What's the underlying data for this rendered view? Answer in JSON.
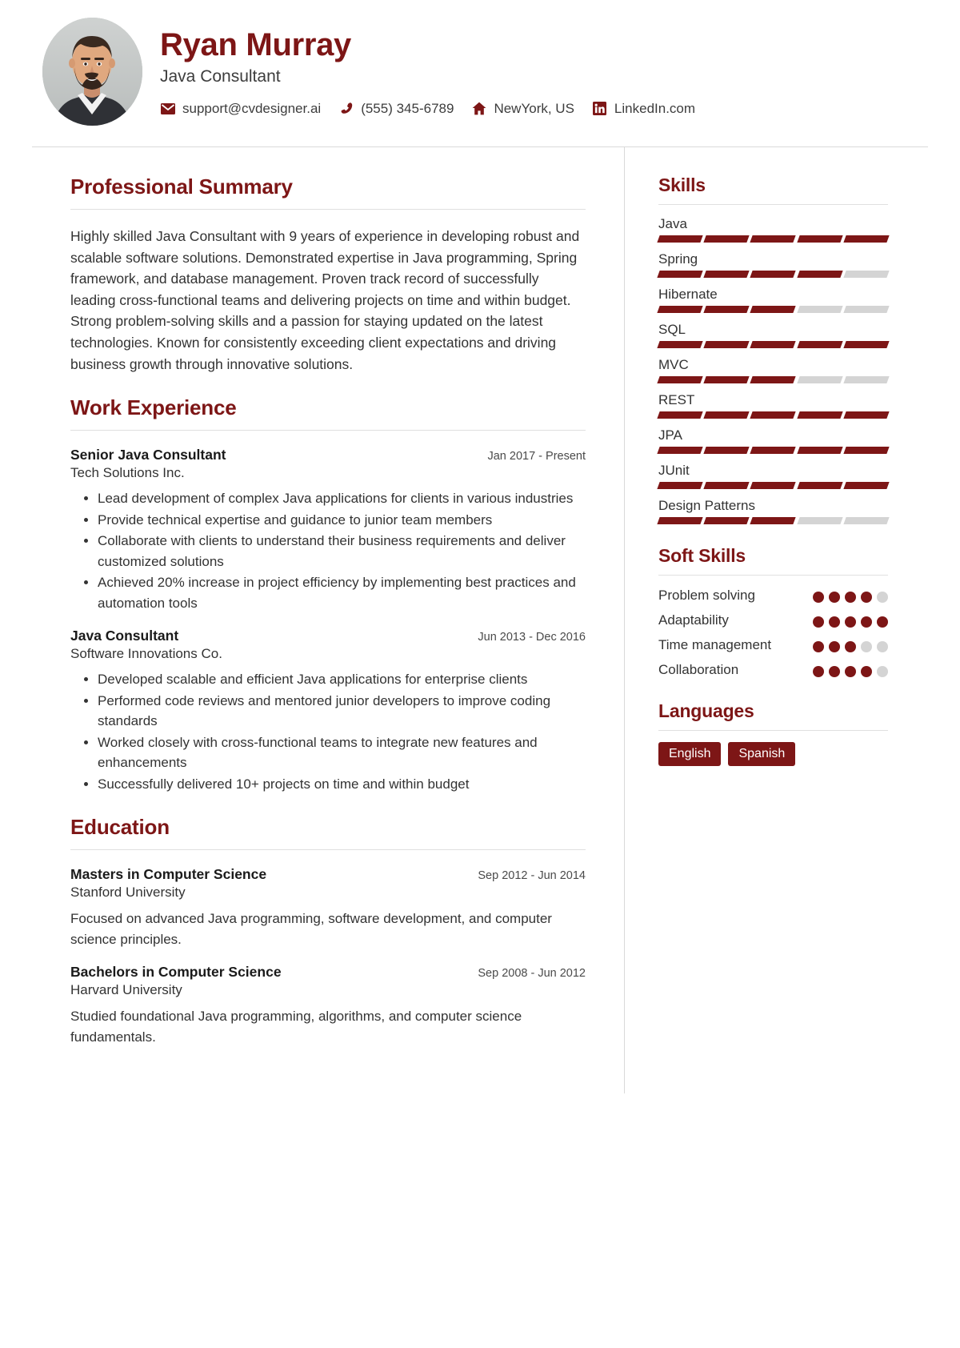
{
  "header": {
    "name": "Ryan Murray",
    "job_title": "Java Consultant",
    "avatar_alt": "profile-photo",
    "contacts": [
      {
        "icon": "envelope-icon",
        "label": "support@cvdesigner.ai"
      },
      {
        "icon": "phone-icon",
        "label": "(555) 345-6789"
      },
      {
        "icon": "home-icon",
        "label": "NewYork, US"
      },
      {
        "icon": "linkedin-icon",
        "label": "LinkedIn.com"
      }
    ]
  },
  "main": {
    "summary": {
      "title": "Professional Summary",
      "text": "Highly skilled Java Consultant with 9 years of experience in developing robust and scalable software solutions. Demonstrated expertise in Java programming, Spring framework, and database management. Proven track record of successfully leading cross-functional teams and delivering projects on time and within budget. Strong problem-solving skills and a passion for staying updated on the latest technologies. Known for consistently exceeding client expectations and driving business growth through innovative solutions."
    },
    "work": {
      "title": "Work Experience",
      "entries": [
        {
          "role": "Senior Java Consultant",
          "date": "Jan 2017 - Present",
          "org": "Tech Solutions Inc.",
          "bullets": [
            "Lead development of complex Java applications for clients in various industries",
            "Provide technical expertise and guidance to junior team members",
            "Collaborate with clients to understand their business requirements and deliver customized solutions",
            "Achieved 20% increase in project efficiency by implementing best practices and automation tools"
          ]
        },
        {
          "role": "Java Consultant",
          "date": "Jun 2013 - Dec 2016",
          "org": "Software Innovations Co.",
          "bullets": [
            "Developed scalable and efficient Java applications for enterprise clients",
            "Performed code reviews and mentored junior developers to improve coding standards",
            "Worked closely with cross-functional teams to integrate new features and enhancements",
            "Successfully delivered 10+ projects on time and within budget"
          ]
        }
      ]
    },
    "education": {
      "title": "Education",
      "entries": [
        {
          "degree": "Masters in Computer Science",
          "date": "Sep 2012 - Jun 2014",
          "school": "Stanford University",
          "description": "Focused on advanced Java programming, software development, and computer science principles."
        },
        {
          "degree": "Bachelors in Computer Science",
          "date": "Sep 2008 - Jun 2012",
          "school": "Harvard University",
          "description": "Studied foundational Java programming, algorithms, and computer science fundamentals."
        }
      ]
    }
  },
  "sidebar": {
    "skills": {
      "title": "Skills",
      "max": 5,
      "items": [
        {
          "name": "Java",
          "level": 5
        },
        {
          "name": "Spring",
          "level": 4
        },
        {
          "name": "Hibernate",
          "level": 3
        },
        {
          "name": "SQL",
          "level": 5
        },
        {
          "name": "MVC",
          "level": 3
        },
        {
          "name": "REST",
          "level": 5
        },
        {
          "name": "JPA",
          "level": 5
        },
        {
          "name": "JUnit",
          "level": 5
        },
        {
          "name": "Design Patterns",
          "level": 3
        }
      ]
    },
    "soft_skills": {
      "title": "Soft Skills",
      "max": 5,
      "items": [
        {
          "name": "Problem solving",
          "level": 4
        },
        {
          "name": "Adaptability",
          "level": 5
        },
        {
          "name": "Time management",
          "level": 3
        },
        {
          "name": "Collaboration",
          "level": 4
        }
      ]
    },
    "languages": {
      "title": "Languages",
      "items": [
        "English",
        "Spanish"
      ]
    }
  },
  "theme": {
    "accent": "#7d1616",
    "text": "#333333",
    "muted": "#d4d4d4",
    "rule": "#e0e0e0"
  }
}
